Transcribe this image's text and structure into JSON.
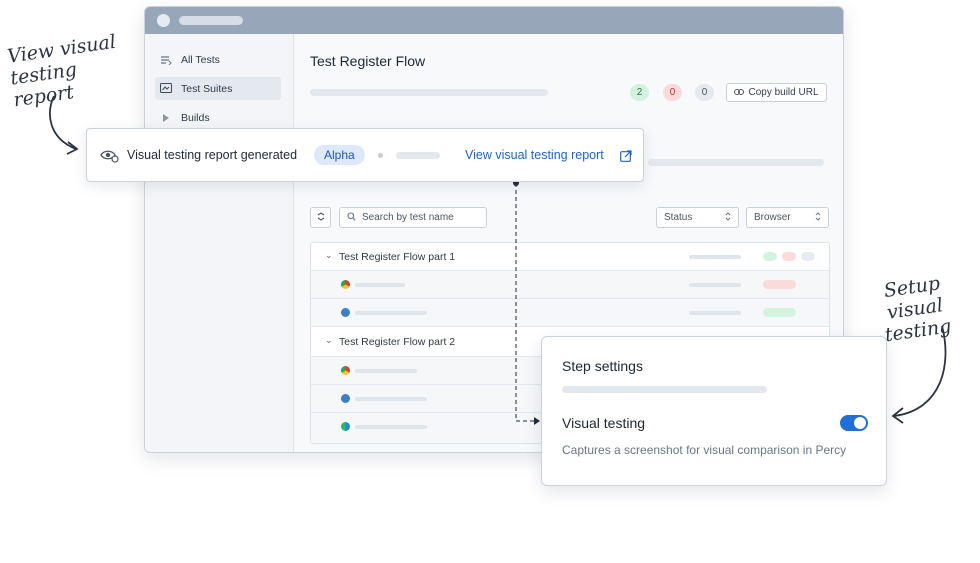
{
  "annotations": {
    "left_line1": "View visual",
    "left_line2": "testing report",
    "right_line1": "Setup visual",
    "right_line2": "testing"
  },
  "sidebar": {
    "items": [
      {
        "label": "All Tests",
        "icon": "list-icon",
        "active": false
      },
      {
        "label": "Test Suites",
        "icon": "suite-icon",
        "active": true
      },
      {
        "label": "Builds",
        "icon": "play-icon",
        "active": false
      }
    ]
  },
  "main": {
    "title": "Test Register Flow",
    "counts": {
      "passed": "2",
      "failed": "0",
      "skipped": "0"
    },
    "copy_label": "Copy build URL",
    "search_placeholder": "Search by test name",
    "status_label": "Status",
    "browser_label": "Browser",
    "groups": [
      {
        "title": "Test Register Flow part 1",
        "rows": [
          "chrome",
          "edge"
        ]
      },
      {
        "title": "Test Register Flow part 2",
        "rows": [
          "chrome",
          "edge",
          "edge"
        ]
      }
    ]
  },
  "notification": {
    "text": "Visual testing report generated",
    "badge": "Alpha",
    "link": "View visual testing report"
  },
  "settings": {
    "title": "Step settings",
    "toggle_label": "Visual testing",
    "toggle_on": true,
    "description": "Captures a screenshot for visual comparison in Percy"
  },
  "colors": {
    "accent": "#1e63c9",
    "pass": "#d4f3df",
    "fail": "#fbdada",
    "neutral": "#e8ecf1"
  }
}
